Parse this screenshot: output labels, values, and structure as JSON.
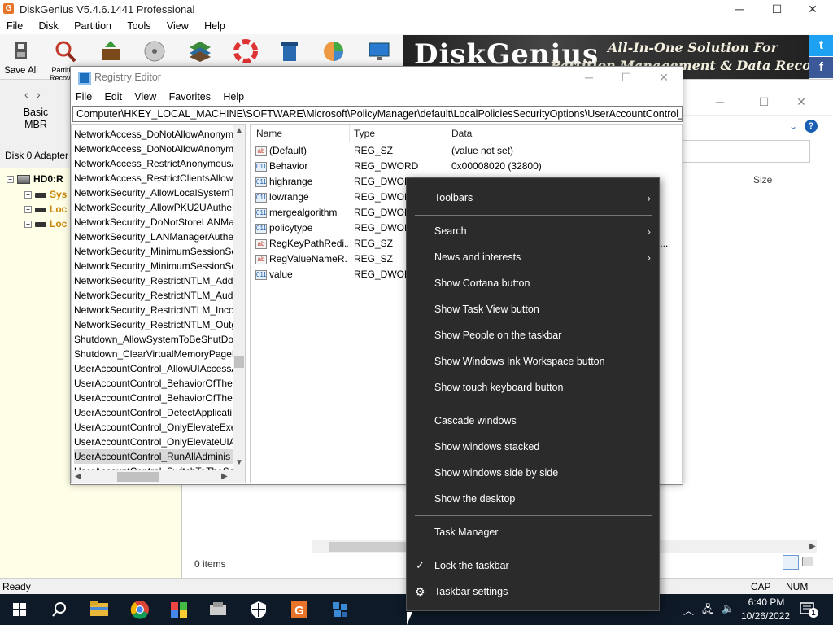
{
  "diskgenius": {
    "title": "DiskGenius V5.4.6.1441 Professional",
    "app_icon": "G",
    "window_controls": {
      "minimize": "─",
      "maximize": "☐",
      "close": "✕"
    },
    "menu": [
      "File",
      "Disk",
      "Partition",
      "Tools",
      "View",
      "Help"
    ],
    "toolbar": {
      "save_all": "Save All",
      "partition_recovery": "Partition Recovery"
    },
    "banner": {
      "logo": "DiskGenius",
      "tagline1": "All-In-One Solution For",
      "tagline2": "Partition Management & Data Recovery",
      "twitter": "t",
      "facebook": "f"
    },
    "left": {
      "nav_back": "‹",
      "nav_forward": "›",
      "basic": "Basic",
      "mbr": "MBR",
      "disk_adapter": "Disk 0 Adapter"
    },
    "tree": {
      "disk": "HD0:R",
      "items": [
        "Sys",
        "Loc",
        "Loc"
      ]
    },
    "status": {
      "ready": "Ready",
      "cap": "CAP",
      "num": "NUM"
    },
    "file_panel": {
      "items_count": "0 items",
      "size_header": "Size",
      "help": "?"
    },
    "colors": {
      "banner_bg": "#222222",
      "tree_bg": "#ffffe8",
      "selected_partition": "#c8860a"
    }
  },
  "registry": {
    "title": "Registry Editor",
    "window_controls": {
      "minimize": "─",
      "maximize": "☐",
      "close": "✕"
    },
    "menu": [
      "File",
      "Edit",
      "View",
      "Favorites",
      "Help"
    ],
    "address": "Computer\\HKEY_LOCAL_MACHINE\\SOFTWARE\\Microsoft\\PolicyManager\\default\\LocalPoliciesSecurityOptions\\UserAccountControl_RunAllAdministratorsInAdminApprovalMode",
    "keys": [
      "NetworkAccess_DoNotAllowAnonym",
      "NetworkAccess_DoNotAllowAnonym",
      "NetworkAccess_RestrictAnonymousA",
      "NetworkAccess_RestrictClientsAllow",
      "NetworkSecurity_AllowLocalSystemT",
      "NetworkSecurity_AllowPKU2UAuther",
      "NetworkSecurity_DoNotStoreLANMa",
      "NetworkSecurity_LANManagerAuthe",
      "NetworkSecurity_MinimumSessionSe",
      "NetworkSecurity_MinimumSessionSe",
      "NetworkSecurity_RestrictNTLM_AddF",
      "NetworkSecurity_RestrictNTLM_Audi",
      "NetworkSecurity_RestrictNTLM_Incor",
      "NetworkSecurity_RestrictNTLM_Outg",
      "Shutdown_AllowSystemToBeShutDov",
      "Shutdown_ClearVirtualMemoryPageF",
      "UserAccountControl_AllowUIAccessA",
      "UserAccountControl_BehaviorOfThe",
      "UserAccountControl_BehaviorOfThe",
      "UserAccountControl_DetectApplicati",
      "UserAccountControl_OnlyElevateExe",
      "UserAccountControl_OnlyElevateUIA",
      "UserAccountControl_RunAllAdminis",
      "UserAccountControl_SwitchToTheSe"
    ],
    "selected_key_index": 22,
    "columns": {
      "name": "Name",
      "type": "Type",
      "data": "Data"
    },
    "values": [
      {
        "name": "(Default)",
        "type": "REG_SZ",
        "data": "(value not set)",
        "icon": "string-value-icon"
      },
      {
        "name": "Behavior",
        "type": "REG_DWORD",
        "data": "0x00008020 (32800)",
        "icon": "dword-value-icon"
      },
      {
        "name": "highrange",
        "type": "REG_DWORD",
        "data": "",
        "icon": "dword-value-icon"
      },
      {
        "name": "lowrange",
        "type": "REG_DWORD",
        "data": "",
        "icon": "dword-value-icon"
      },
      {
        "name": "mergealgorithm",
        "type": "REG_DWORD",
        "data": "",
        "icon": "dword-value-icon"
      },
      {
        "name": "policytype",
        "type": "REG_DWORD",
        "data": "",
        "icon": "dword-value-icon"
      },
      {
        "name": "RegKeyPathRedi...",
        "type": "REG_SZ",
        "data": "li...",
        "icon": "string-value-icon"
      },
      {
        "name": "RegValueNameR...",
        "type": "REG_SZ",
        "data": "",
        "icon": "string-value-icon"
      },
      {
        "name": "value",
        "type": "REG_DWORD",
        "data": "",
        "icon": "dword-value-icon"
      }
    ]
  },
  "context_menu": {
    "items": [
      {
        "label": "Toolbars",
        "submenu": true
      },
      {
        "label": "Search",
        "submenu": true
      },
      {
        "label": "News and interests",
        "submenu": true
      },
      {
        "label": "Show Cortana button"
      },
      {
        "label": "Show Task View button"
      },
      {
        "label": "Show People on the taskbar"
      },
      {
        "label": "Show Windows Ink Workspace button"
      },
      {
        "label": "Show touch keyboard button"
      },
      {
        "label": "Cascade windows"
      },
      {
        "label": "Show windows stacked"
      },
      {
        "label": "Show windows side by side"
      },
      {
        "label": "Show the desktop"
      },
      {
        "label": "Task Manager"
      },
      {
        "label": "Lock the taskbar",
        "checked": true
      },
      {
        "label": "Taskbar settings",
        "icon": "gear-icon"
      }
    ],
    "chevron": "›",
    "check": "✓",
    "gear": "⚙"
  },
  "taskbar": {
    "time": "6:40 PM",
    "date": "10/26/2022",
    "notification_count": "1",
    "apps": [
      "start-icon",
      "search-icon",
      "file-explorer-icon",
      "chrome-icon",
      "windows-xp-icon",
      "network-icon",
      "security-icon",
      "diskgenius-icon",
      "registry-icon"
    ]
  }
}
